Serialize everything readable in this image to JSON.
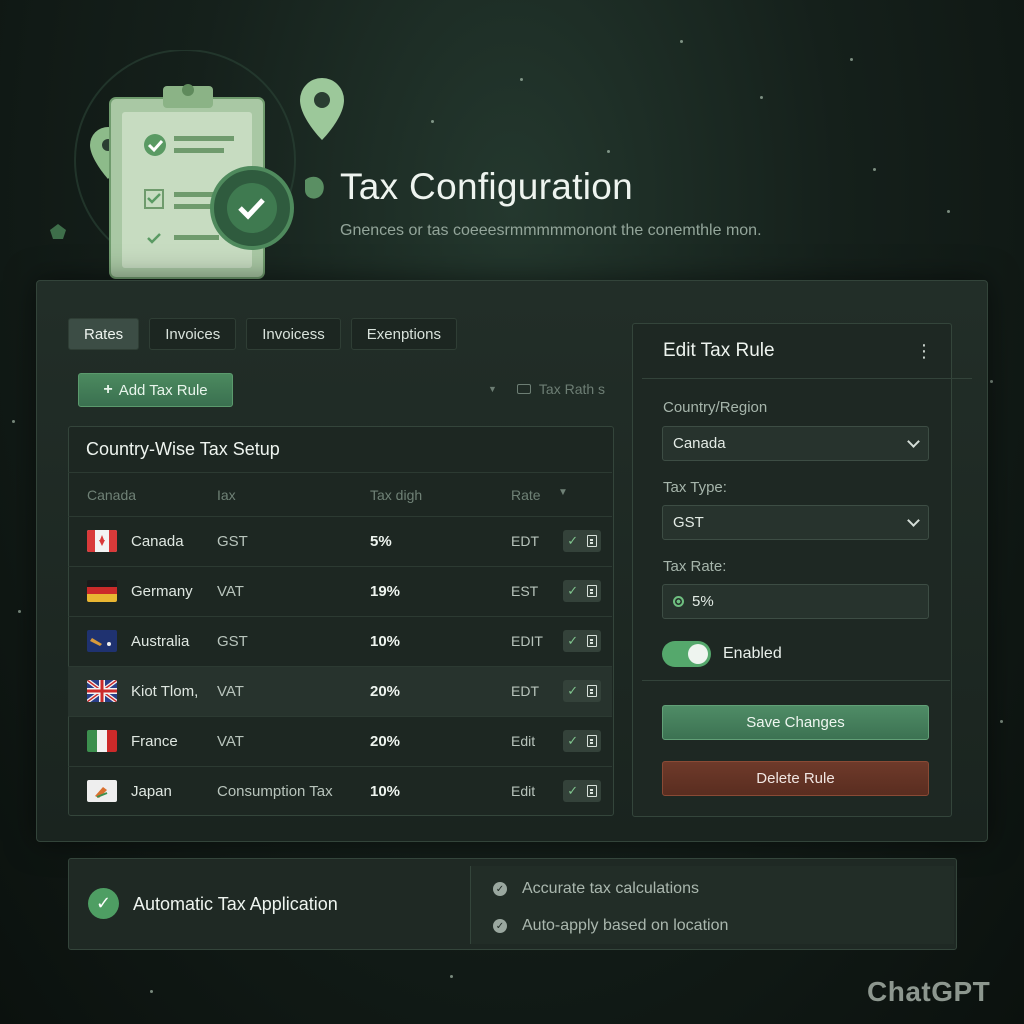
{
  "header": {
    "title": "Tax Configuration",
    "subtitle": "Gnences or tas coeeesrmmmmmonont the conemthle mon."
  },
  "tabs": [
    {
      "label": "Rates",
      "active": true
    },
    {
      "label": "Invoices",
      "active": false
    },
    {
      "label": "Invoicess",
      "active": false
    },
    {
      "label": "Exenptions",
      "active": false
    }
  ],
  "toolbar": {
    "add_button_label": "Add Tax Rule",
    "add_icon": "plus-icon",
    "filter_label": "Tax Rath s"
  },
  "table": {
    "title": "Country-Wise Tax Setup",
    "headers": [
      "Canada",
      "Iax",
      "Tax digh",
      "Rate"
    ],
    "rows": [
      {
        "country": "Canada",
        "tax": "GST",
        "rate": "5%",
        "action": "EDT",
        "flag": "canada-flag-icon"
      },
      {
        "country": "Germany",
        "tax": "VAT",
        "rate": "19%",
        "action": "EST",
        "flag": "germany-flag-icon"
      },
      {
        "country": "Australia",
        "tax": "GST",
        "rate": "10%",
        "action": "EDIT",
        "flag": "australia-flag-icon"
      },
      {
        "country": "Kiot Tlom,",
        "tax": "VAT",
        "rate": "20%",
        "action": "EDT",
        "flag": "uk-flag-icon"
      },
      {
        "country": "France",
        "tax": "VAT",
        "rate": "20%",
        "action": "Edit",
        "flag": "france-flag-icon"
      },
      {
        "country": "Japan",
        "tax": "Consumption Tax",
        "rate": "10%",
        "action": "Edit",
        "flag": "japan-flag-icon"
      }
    ]
  },
  "edit_panel": {
    "title": "Edit Tax Rule",
    "country_label": "Country/Region",
    "country_value": "Canada",
    "tax_type_label": "Tax Type:",
    "tax_type_value": "GST",
    "tax_rate_label": "Tax Rate:",
    "tax_rate_value": "5%",
    "enabled_label": "Enabled",
    "enabled": true,
    "save_label": "Save Changes",
    "delete_label": "Delete Rule"
  },
  "banner": {
    "title": "Automatic Tax Application",
    "features": [
      "Accurate tax calculations",
      "Auto-apply based on location"
    ]
  },
  "watermark": "ChatGPT",
  "colors": {
    "accent_green": "#4e9e63",
    "danger": "#6e3a2a",
    "background": "#15201b"
  }
}
